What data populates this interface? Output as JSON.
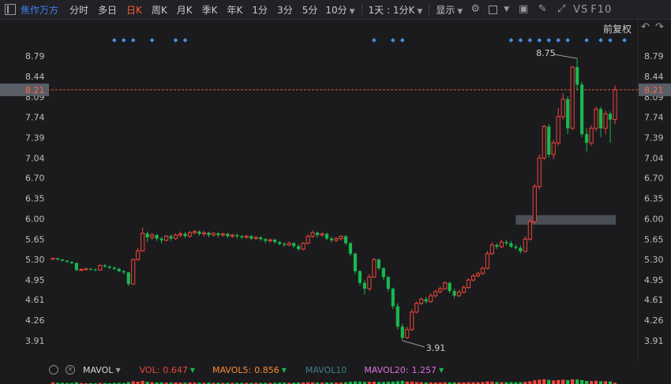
{
  "toolbar": {
    "stock_name": "焦作万方",
    "tabs": [
      {
        "label": "分时",
        "active": false
      },
      {
        "label": "多日",
        "active": false
      },
      {
        "label": "日K",
        "active": true
      },
      {
        "label": "周K",
        "active": false
      },
      {
        "label": "月K",
        "active": false
      },
      {
        "label": "季K",
        "active": false
      },
      {
        "label": "年K",
        "active": false
      },
      {
        "label": "1分",
        "active": false
      },
      {
        "label": "3分",
        "active": false
      },
      {
        "label": "5分",
        "active": false
      }
    ],
    "period_dropdown": "10分",
    "ratio_dropdown": "1天 : 1分K",
    "display_dropdown": "显示",
    "vs_text": "VS",
    "f10_text": "F10"
  },
  "adjust_label": "前复权",
  "volume_bar": {
    "indicator": "MAVOL",
    "vol_label": "VOL:",
    "vol_value": "0.647",
    "mavol5_label": "MAVOL5:",
    "mavol5_value": "0.856",
    "mavol10_label": "MAVOL10",
    "mavol20_label": "MAVOL20:",
    "mavol20_value": "1.257"
  },
  "colors": {
    "up": "#f0443c",
    "down": "#19b84f",
    "accent": "#3f7df0",
    "crosshair": "#e0592a",
    "price_tag_bg": "#5a5e66",
    "mavol5": "#ff8c37",
    "mavol10": "#3f7d8c",
    "mavol20": "#e070e0"
  },
  "chart_data": {
    "type": "candlestick",
    "y_ticks": [
      "8.79",
      "8.44",
      "8.09",
      "7.74",
      "7.39",
      "7.04",
      "6.70",
      "6.35",
      "6.00",
      "5.65",
      "5.30",
      "4.95",
      "4.61",
      "4.26",
      "3.91"
    ],
    "ylim": [
      3.91,
      8.79
    ],
    "current_price": "8.21",
    "max_label": "8.75",
    "min_label": "3.91",
    "highlight_level": 5.98,
    "event_markers": [
      13,
      15,
      17,
      21,
      26,
      28,
      68,
      72,
      74,
      97,
      99,
      101,
      103,
      105,
      107,
      109,
      113,
      116,
      118,
      121
    ],
    "candles": [
      [
        5.31,
        5.32,
        5.33,
        5.3
      ],
      [
        5.32,
        5.3,
        5.33,
        5.29
      ],
      [
        5.3,
        5.28,
        5.31,
        5.27
      ],
      [
        5.28,
        5.26,
        5.29,
        5.25
      ],
      [
        5.26,
        5.24,
        5.27,
        5.22
      ],
      [
        5.24,
        5.12,
        5.25,
        5.1
      ],
      [
        5.12,
        5.13,
        5.15,
        5.1
      ],
      [
        5.13,
        5.14,
        5.16,
        5.12
      ],
      [
        5.14,
        5.13,
        5.16,
        5.11
      ],
      [
        5.13,
        5.12,
        5.15,
        5.1
      ],
      [
        5.12,
        5.2,
        5.22,
        5.11
      ],
      [
        5.2,
        5.18,
        5.22,
        5.16
      ],
      [
        5.18,
        5.16,
        5.2,
        5.14
      ],
      [
        5.16,
        5.14,
        5.18,
        5.12
      ],
      [
        5.14,
        5.1,
        5.16,
        5.08
      ],
      [
        5.1,
        5.08,
        5.12,
        5.05
      ],
      [
        5.08,
        4.88,
        5.09,
        4.85
      ],
      [
        4.88,
        5.3,
        5.32,
        4.87
      ],
      [
        5.3,
        5.45,
        5.5,
        5.28
      ],
      [
        5.45,
        5.75,
        5.85,
        5.44
      ],
      [
        5.75,
        5.68,
        5.78,
        5.6
      ],
      [
        5.68,
        5.72,
        5.76,
        5.64
      ],
      [
        5.72,
        5.66,
        5.74,
        5.62
      ],
      [
        5.66,
        5.63,
        5.69,
        5.58
      ],
      [
        5.63,
        5.7,
        5.72,
        5.61
      ],
      [
        5.7,
        5.66,
        5.73,
        5.62
      ],
      [
        5.66,
        5.72,
        5.75,
        5.64
      ],
      [
        5.72,
        5.74,
        5.78,
        5.68
      ],
      [
        5.74,
        5.7,
        5.77,
        5.67
      ],
      [
        5.7,
        5.76,
        5.79,
        5.68
      ],
      [
        5.76,
        5.78,
        5.81,
        5.73
      ],
      [
        5.78,
        5.74,
        5.8,
        5.71
      ],
      [
        5.74,
        5.76,
        5.79,
        5.7
      ],
      [
        5.76,
        5.72,
        5.78,
        5.68
      ],
      [
        5.72,
        5.75,
        5.77,
        5.7
      ],
      [
        5.75,
        5.72,
        5.77,
        5.68
      ],
      [
        5.72,
        5.74,
        5.76,
        5.69
      ],
      [
        5.74,
        5.7,
        5.76,
        5.67
      ],
      [
        5.7,
        5.72,
        5.74,
        5.67
      ],
      [
        5.72,
        5.7,
        5.74,
        5.66
      ],
      [
        5.7,
        5.68,
        5.72,
        5.65
      ],
      [
        5.68,
        5.7,
        5.72,
        5.66
      ],
      [
        5.7,
        5.66,
        5.72,
        5.63
      ],
      [
        5.66,
        5.68,
        5.7,
        5.64
      ],
      [
        5.68,
        5.65,
        5.7,
        5.62
      ],
      [
        5.65,
        5.62,
        5.67,
        5.58
      ],
      [
        5.62,
        5.64,
        5.66,
        5.59
      ],
      [
        5.64,
        5.6,
        5.66,
        5.57
      ],
      [
        5.6,
        5.57,
        5.62,
        5.54
      ],
      [
        5.57,
        5.55,
        5.6,
        5.52
      ],
      [
        5.55,
        5.58,
        5.61,
        5.53
      ],
      [
        5.58,
        5.53,
        5.6,
        5.5
      ],
      [
        5.53,
        5.48,
        5.56,
        5.45
      ],
      [
        5.48,
        5.58,
        5.6,
        5.46
      ],
      [
        5.58,
        5.7,
        5.73,
        5.56
      ],
      [
        5.7,
        5.76,
        5.8,
        5.67
      ],
      [
        5.76,
        5.72,
        5.78,
        5.68
      ],
      [
        5.72,
        5.74,
        5.77,
        5.69
      ],
      [
        5.74,
        5.66,
        5.76,
        5.63
      ],
      [
        5.66,
        5.63,
        5.69,
        5.59
      ],
      [
        5.63,
        5.66,
        5.69,
        5.6
      ],
      [
        5.66,
        5.7,
        5.72,
        5.63
      ],
      [
        5.7,
        5.58,
        5.72,
        5.55
      ],
      [
        5.58,
        5.4,
        5.6,
        5.36
      ],
      [
        5.4,
        5.1,
        5.42,
        5.05
      ],
      [
        5.1,
        4.9,
        5.12,
        4.85
      ],
      [
        4.9,
        4.8,
        4.95,
        4.7
      ],
      [
        4.8,
        5.0,
        5.05,
        4.76
      ],
      [
        5.0,
        5.3,
        5.33,
        4.98
      ],
      [
        5.3,
        5.15,
        5.32,
        5.12
      ],
      [
        5.15,
        5.0,
        5.17,
        4.95
      ],
      [
        5.0,
        4.8,
        5.02,
        4.75
      ],
      [
        4.8,
        4.5,
        4.82,
        4.45
      ],
      [
        4.5,
        4.15,
        4.55,
        4.1
      ],
      [
        4.15,
        3.96,
        4.2,
        3.91
      ],
      [
        3.96,
        4.1,
        4.15,
        3.94
      ],
      [
        4.1,
        4.4,
        4.45,
        4.08
      ],
      [
        4.4,
        4.55,
        4.58,
        4.38
      ],
      [
        4.55,
        4.62,
        4.65,
        4.52
      ],
      [
        4.62,
        4.58,
        4.66,
        4.55
      ],
      [
        4.58,
        4.68,
        4.72,
        4.56
      ],
      [
        4.68,
        4.75,
        4.78,
        4.65
      ],
      [
        4.75,
        4.8,
        4.84,
        4.72
      ],
      [
        4.8,
        4.9,
        4.93,
        4.78
      ],
      [
        4.9,
        4.76,
        4.92,
        4.72
      ],
      [
        4.76,
        4.68,
        4.8,
        4.64
      ],
      [
        4.68,
        4.74,
        4.78,
        4.66
      ],
      [
        4.74,
        4.82,
        4.86,
        4.72
      ],
      [
        4.82,
        4.95,
        4.98,
        4.8
      ],
      [
        4.95,
        5.02,
        5.05,
        4.92
      ],
      [
        5.02,
        5.06,
        5.09,
        5.0
      ],
      [
        5.06,
        5.15,
        5.18,
        5.04
      ],
      [
        5.15,
        5.4,
        5.45,
        5.13
      ],
      [
        5.4,
        5.55,
        5.6,
        5.38
      ],
      [
        5.55,
        5.52,
        5.58,
        5.48
      ],
      [
        5.52,
        5.6,
        5.64,
        5.5
      ],
      [
        5.6,
        5.58,
        5.64,
        5.54
      ],
      [
        5.58,
        5.52,
        5.62,
        5.5
      ],
      [
        5.52,
        5.5,
        5.56,
        5.47
      ],
      [
        5.5,
        5.44,
        5.54,
        5.4
      ],
      [
        5.44,
        5.65,
        5.7,
        5.42
      ],
      [
        5.65,
        5.95,
        6.0,
        5.62
      ],
      [
        5.95,
        6.55,
        6.6,
        5.92
      ],
      [
        6.55,
        7.04,
        7.1,
        6.5
      ],
      [
        7.04,
        7.58,
        7.62,
        7.0
      ],
      [
        7.58,
        7.1,
        7.62,
        7.05
      ],
      [
        7.1,
        7.3,
        7.35,
        7.02
      ],
      [
        7.3,
        7.75,
        7.9,
        7.25
      ],
      [
        7.75,
        8.05,
        8.15,
        7.7
      ],
      [
        8.05,
        7.55,
        8.1,
        7.45
      ],
      [
        7.55,
        8.6,
        8.62,
        7.52
      ],
      [
        8.6,
        8.3,
        8.75,
        8.2
      ],
      [
        8.3,
        7.45,
        8.35,
        7.4
      ],
      [
        7.45,
        7.3,
        7.55,
        7.15
      ],
      [
        7.3,
        7.55,
        7.6,
        7.25
      ],
      [
        7.55,
        7.88,
        7.92,
        7.5
      ],
      [
        7.88,
        7.55,
        7.92,
        7.4
      ],
      [
        7.55,
        7.8,
        7.85,
        7.45
      ],
      [
        7.8,
        7.7,
        7.84,
        7.3
      ],
      [
        7.7,
        8.21,
        8.28,
        7.62
      ]
    ],
    "volume_cols": [
      0.8,
      0.6,
      0.6,
      0.5,
      0.5,
      0.9,
      0.5,
      0.4,
      0.5,
      0.4,
      0.6,
      0.5,
      0.4,
      0.5,
      0.6,
      0.5,
      1.0,
      1.4,
      1.2,
      1.6,
      1.1,
      0.9,
      0.8,
      0.8,
      0.7,
      0.7,
      0.8,
      0.7,
      0.7,
      0.8,
      0.7,
      0.7,
      0.6,
      0.7,
      0.6,
      0.6,
      0.6,
      0.6,
      0.6,
      0.6,
      0.6,
      0.6,
      0.6,
      0.6,
      0.6,
      0.6,
      0.6,
      0.6,
      0.7,
      0.7,
      0.6,
      0.7,
      0.8,
      0.8,
      0.9,
      0.8,
      0.7,
      0.7,
      0.8,
      0.7,
      0.7,
      0.7,
      0.9,
      1.1,
      1.3,
      1.2,
      1.1,
      1.1,
      1.2,
      1.0,
      1.0,
      1.1,
      1.2,
      1.4,
      1.6,
      1.2,
      1.2,
      1.0,
      0.9,
      0.8,
      0.8,
      0.8,
      0.8,
      0.9,
      0.8,
      0.8,
      0.8,
      0.8,
      0.9,
      0.9,
      0.9,
      1.0,
      1.3,
      1.2,
      1.0,
      0.9,
      0.9,
      0.9,
      0.9,
      0.9,
      1.1,
      1.4,
      1.9,
      2.2,
      2.4,
      2.1,
      1.8,
      2.0,
      2.2,
      2.0,
      2.4,
      2.3,
      2.0,
      1.6,
      1.5,
      1.6,
      1.4,
      1.4,
      1.3,
      0.647
    ]
  }
}
